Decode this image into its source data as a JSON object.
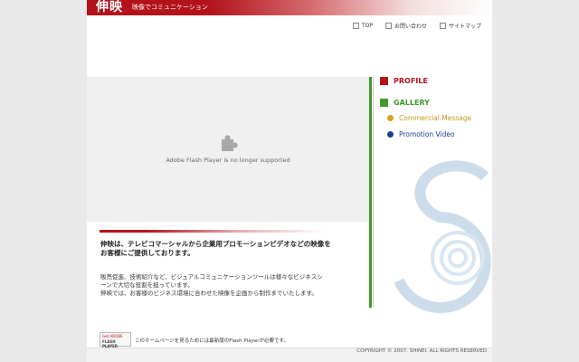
{
  "header": {
    "logo": "伸映",
    "tagline": "映像でコミュニケーション",
    "brand_color": "#b3121b"
  },
  "topnav": [
    {
      "label": "TOP"
    },
    {
      "label": "お問い合わせ"
    },
    {
      "label": "サイトマップ"
    }
  ],
  "flash": {
    "message": "Adobe Flash Player is no longer supported",
    "icon": "puzzle-piece-icon"
  },
  "sidenav": {
    "profile": {
      "label": "PROFILE",
      "color": "#b3121b"
    },
    "gallery": {
      "label": "GALLERY",
      "color": "#3f9a2a"
    },
    "commercial": {
      "label": "Commercial Message",
      "color": "#d6a21a"
    },
    "promotion": {
      "label": "Promotion Video",
      "color": "#1f3f8a"
    }
  },
  "content": {
    "headline_1": "伸映は、テレビコマーシャルから企業用プロモーションビデオなどの映像を",
    "headline_2": "お客様にご提供しております。",
    "body_1": "販売促進、技術紹介など、ビジュアルコミュニケーションツールは様々なビジネスシ",
    "body_2": "ーンで大切な役割を担っています。",
    "body_3": "伸映では、お客様のビジネス環境に合わせた映像を企画から制作までいたします。"
  },
  "footer": {
    "badge_top": "Get ADOBE",
    "badge_bottom": "FLASH PLAYER",
    "note": "このホームページを見るためには最新版のFlash Playerが必要です。",
    "copyright": "COPYRIGHT © 2007. SHINEI.  ALL RIGHTS RESERVED"
  }
}
